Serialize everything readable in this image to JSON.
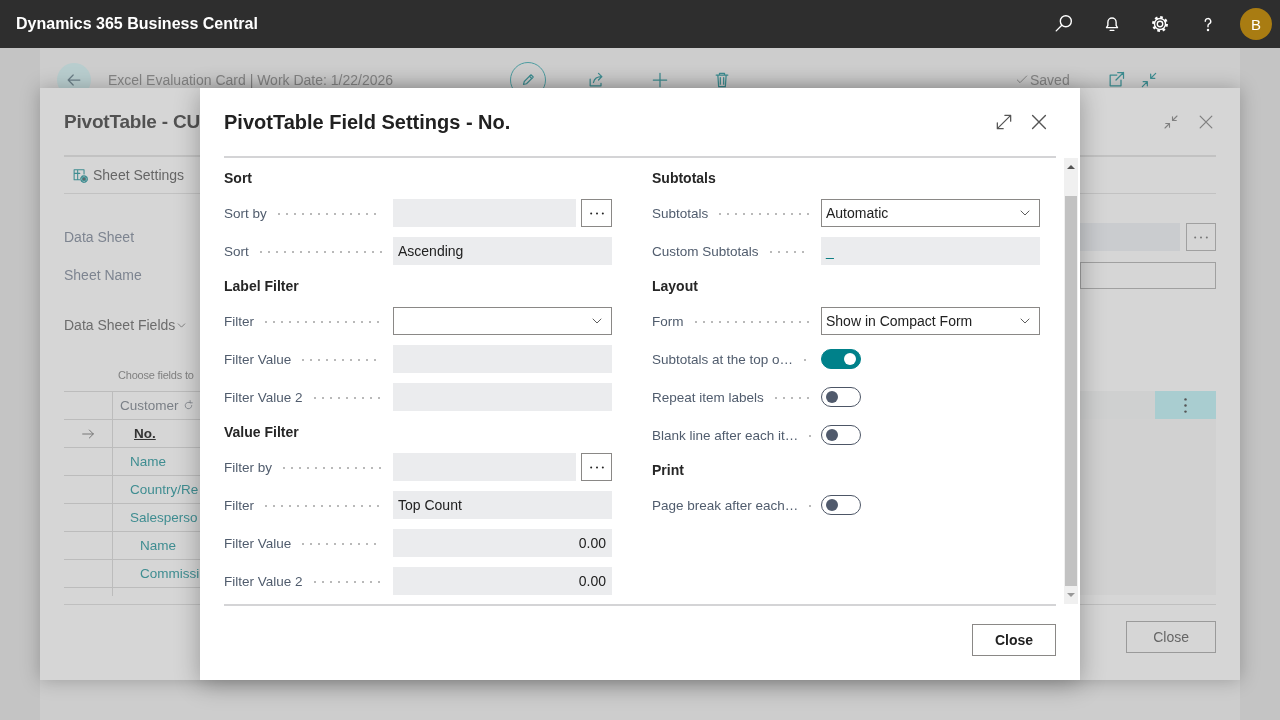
{
  "app_bar": {
    "title": "Dynamics 365 Business Central",
    "avatar": "B"
  },
  "page": {
    "title": "Excel Evaluation Card | Work Date: 1/22/2026",
    "status": "Saved"
  },
  "evaluation_dialog": {
    "title": "PivotTable - CU",
    "actions": [
      {
        "label": "Sheet Settings"
      }
    ],
    "fields": [
      {
        "label": "Data Sheet",
        "kind": "lookup"
      },
      {
        "label": "Sheet Name",
        "kind": "text"
      }
    ],
    "group": {
      "label": "Data Sheet Fields",
      "expanded": true
    },
    "hint": "Choose fields to",
    "table": {
      "column_1": "Customer",
      "rows": [
        {
          "label": "No.",
          "selected": true
        },
        {
          "label": "Name",
          "selected": false
        },
        {
          "label": "Country/Re",
          "selected": false
        },
        {
          "label": "Salesperso",
          "selected": false,
          "children": [
            {
              "label": "Name",
              "selected": false
            },
            {
              "label": "Commissi",
              "selected": false
            }
          ]
        }
      ]
    },
    "close_button": "Close"
  },
  "field_settings_dialog": {
    "title": "PivotTable Field Settings - No.",
    "columns": [
      {
        "sections": [
          {
            "heading": "Sort",
            "fields": [
              {
                "label": "Sort by",
                "kind": "lookup"
              },
              {
                "label": "Sort",
                "kind": "text",
                "value": "Ascending"
              }
            ]
          },
          {
            "heading": "Label Filter",
            "fields": [
              {
                "label": "Filter",
                "kind": "dropdown"
              },
              {
                "label": "Filter Value",
                "kind": "text"
              },
              {
                "label": "Filter Value 2",
                "kind": "text"
              }
            ]
          },
          {
            "heading": "Value Filter",
            "fields": [
              {
                "label": "Filter by",
                "kind": "lookup"
              },
              {
                "label": "Filter",
                "kind": "text",
                "value": "Top Count"
              },
              {
                "label": "Filter Value",
                "kind": "number",
                "value": "0.00"
              },
              {
                "label": "Filter Value 2",
                "kind": "number",
                "value": "0.00"
              }
            ]
          }
        ]
      },
      {
        "sections": [
          {
            "heading": "Subtotals",
            "fields": [
              {
                "label": "Subtotals",
                "kind": "dropdown",
                "value": "Automatic"
              },
              {
                "label": "Custom Subtotals",
                "kind": "drilldown",
                "value": "_"
              }
            ]
          },
          {
            "heading": "Layout",
            "fields": [
              {
                "label": "Form",
                "kind": "dropdown",
                "value": "Show in Compact Form"
              },
              {
                "label": "Subtotals at the top o…",
                "kind": "toggle",
                "on": true
              },
              {
                "label": "Repeat item labels",
                "kind": "toggle",
                "on": false
              },
              {
                "label": "Blank line after each it…",
                "kind": "toggle",
                "on": false
              }
            ]
          },
          {
            "heading": "Print",
            "fields": [
              {
                "label": "Page break after each…",
                "kind": "toggle",
                "on": false
              }
            ]
          }
        ]
      }
    ],
    "close_button": "Close"
  }
}
